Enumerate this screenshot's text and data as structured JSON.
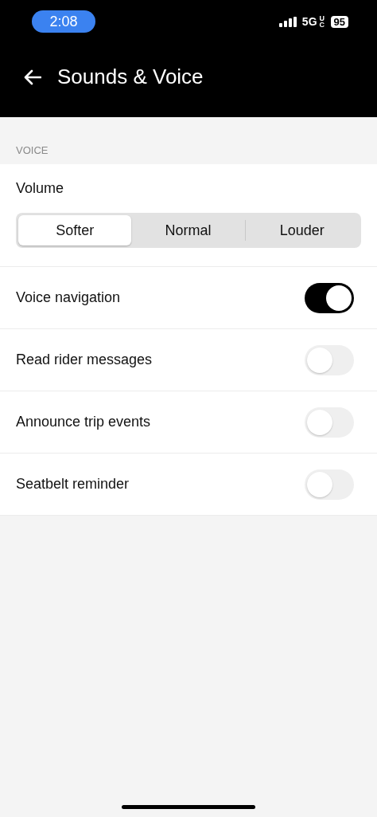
{
  "status_bar": {
    "time": "2:08",
    "network": "5G",
    "network_suffix": "UC",
    "battery": "95"
  },
  "header": {
    "title": "Sounds & Voice"
  },
  "section": {
    "label": "VOICE"
  },
  "volume": {
    "label": "Volume",
    "options": [
      {
        "label": "Softer",
        "selected": true
      },
      {
        "label": "Normal",
        "selected": false
      },
      {
        "label": "Louder",
        "selected": false
      }
    ]
  },
  "settings": [
    {
      "label": "Voice navigation",
      "on": true
    },
    {
      "label": "Read rider messages",
      "on": false
    },
    {
      "label": "Announce trip events",
      "on": false
    },
    {
      "label": "Seatbelt reminder",
      "on": false
    }
  ]
}
